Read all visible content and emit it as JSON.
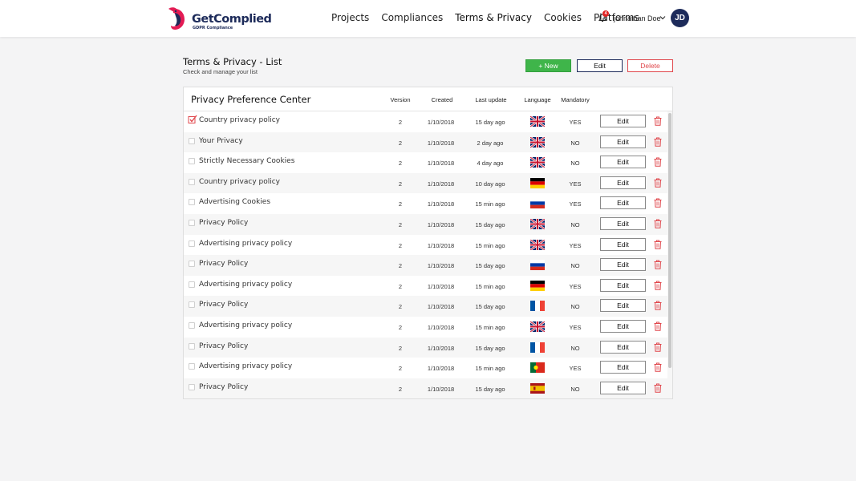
{
  "brand": {
    "name": "GetComplied",
    "tagline": "GDPR Compliance"
  },
  "nav": [
    {
      "label": "Projects"
    },
    {
      "label": "Compliances"
    },
    {
      "label": "Terms & Privacy"
    },
    {
      "label": "Cookies"
    },
    {
      "label": "Platforms"
    }
  ],
  "notifications": {
    "count": "4"
  },
  "user": {
    "name": "johnathan Doe",
    "initials": "JD"
  },
  "page": {
    "title": "Terms & Privacy - List",
    "subtitle": "Check and manage your list"
  },
  "actions": {
    "new_label": "+ New",
    "edit_label": "Edit",
    "delete_label": "Delete"
  },
  "table": {
    "title": "Privacy Preference Center",
    "headers": {
      "version": "Version",
      "created": "Created",
      "last_update": "Last update",
      "language": "Language",
      "mandatory": "Mandatory"
    },
    "edit_label": "Edit",
    "rows": [
      {
        "checked": true,
        "name": "Country privacy policy",
        "version": "2",
        "created": "1/10/2018",
        "updated": "15 day ago",
        "flag": "uk",
        "mandatory": "YES"
      },
      {
        "checked": false,
        "name": "Your Privacy",
        "version": "2",
        "created": "1/10/2018",
        "updated": "2 day ago",
        "flag": "uk",
        "mandatory": "NO"
      },
      {
        "checked": false,
        "name": "Strictly Necessary Cookies",
        "version": "2",
        "created": "1/10/2018",
        "updated": "4 day ago",
        "flag": "uk",
        "mandatory": "NO"
      },
      {
        "checked": false,
        "name": "Country privacy policy",
        "version": "2",
        "created": "1/10/2018",
        "updated": "10 day ago",
        "flag": "de",
        "mandatory": "YES"
      },
      {
        "checked": false,
        "name": "Advertising Cookies",
        "version": "2",
        "created": "1/10/2018",
        "updated": "15 min ago",
        "flag": "ru",
        "mandatory": "YES"
      },
      {
        "checked": false,
        "name": "Privacy Policy",
        "version": "2",
        "created": "1/10/2018",
        "updated": "15 day ago",
        "flag": "uk",
        "mandatory": "NO"
      },
      {
        "checked": false,
        "name": "Advertising privacy policy",
        "version": "2",
        "created": "1/10/2018",
        "updated": "15 min ago",
        "flag": "uk",
        "mandatory": "YES"
      },
      {
        "checked": false,
        "name": "Privacy Policy",
        "version": "2",
        "created": "1/10/2018",
        "updated": "15 day ago",
        "flag": "ru",
        "mandatory": "NO"
      },
      {
        "checked": false,
        "name": "Advertising privacy policy",
        "version": "2",
        "created": "1/10/2018",
        "updated": "15 min ago",
        "flag": "de",
        "mandatory": "YES"
      },
      {
        "checked": false,
        "name": "Privacy Policy",
        "version": "2",
        "created": "1/10/2018",
        "updated": "15 day ago",
        "flag": "fr",
        "mandatory": "NO"
      },
      {
        "checked": false,
        "name": "Advertising privacy policy",
        "version": "2",
        "created": "1/10/2018",
        "updated": "15 min ago",
        "flag": "uk",
        "mandatory": "YES"
      },
      {
        "checked": false,
        "name": "Privacy Policy",
        "version": "2",
        "created": "1/10/2018",
        "updated": "15 day ago",
        "flag": "fr",
        "mandatory": "NO"
      },
      {
        "checked": false,
        "name": "Advertising privacy policy",
        "version": "2",
        "created": "1/10/2018",
        "updated": "15 min ago",
        "flag": "pt",
        "mandatory": "YES"
      },
      {
        "checked": false,
        "name": "Privacy Policy",
        "version": "2",
        "created": "1/10/2018",
        "updated": "15 day ago",
        "flag": "es",
        "mandatory": "NO"
      }
    ]
  },
  "colors": {
    "brand_navy": "#1d2b5a",
    "new_green": "#3fb54a",
    "delete_red": "#e0474c"
  }
}
